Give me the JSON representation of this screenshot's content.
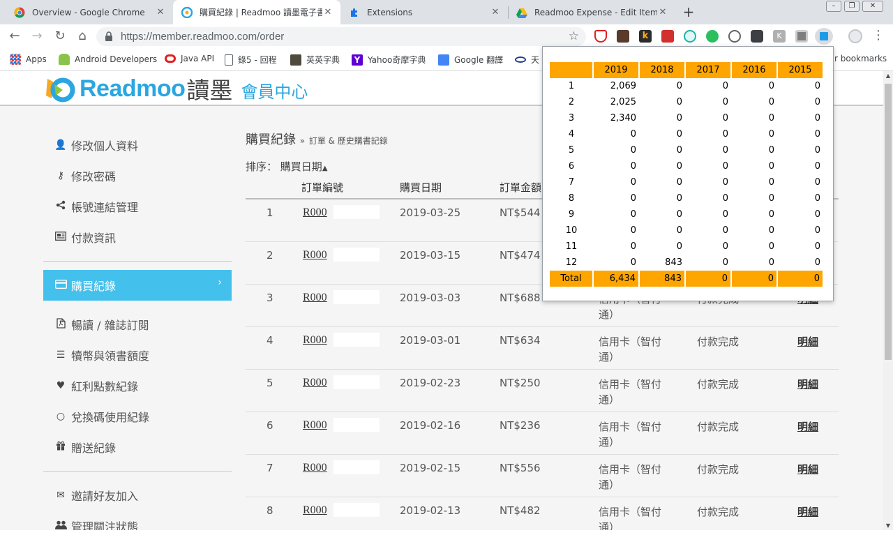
{
  "browser": {
    "tabs": [
      {
        "title": "Overview - Google Chrome",
        "active": false
      },
      {
        "title": "購買紀錄 | Readmoo 讀墨電子書",
        "active": true
      },
      {
        "title": "Extensions",
        "active": false
      },
      {
        "title": "Readmoo Expense - Edit Item",
        "active": false
      }
    ],
    "url_host": "https://member.readmoo.com",
    "url_path": "/order",
    "bookmarks": [
      {
        "label": "Apps",
        "icon": "apps-grid-icon"
      },
      {
        "label": "Android Developers",
        "icon": "android-icon"
      },
      {
        "label": "Java API",
        "icon": "oracle-icon"
      },
      {
        "label": "錄5 - 回程",
        "icon": "document-icon"
      },
      {
        "label": "英英字典",
        "icon": "book-icon"
      },
      {
        "label": "Yahoo奇摩字典",
        "icon": "yahoo-icon"
      },
      {
        "label": "Google 翻譯",
        "icon": "translate-icon"
      },
      {
        "label": "天",
        "icon": "eye-icon"
      }
    ],
    "other_bookmarks": "r bookmarks"
  },
  "site": {
    "brand": "Readmoo",
    "brand_zh": "讀墨",
    "member_center": "會員中心"
  },
  "sidebar": {
    "items": [
      {
        "label": "修改個人資料",
        "icon": "user-icon"
      },
      {
        "label": "修改密碼",
        "icon": "key-icon"
      },
      {
        "label": "帳號連結管理",
        "icon": "share-icon"
      },
      {
        "label": "付款資訊",
        "icon": "newspaper-icon"
      }
    ],
    "active_item": {
      "label": "購買紀錄",
      "icon": "credit-card-icon",
      "chevron": "›"
    },
    "items2": [
      {
        "label": "暢讀 / 雜誌訂閱",
        "icon": "pdf-file-icon"
      },
      {
        "label": "犢幣與領書額度",
        "icon": "list-icon"
      },
      {
        "label": "紅利點數紀錄",
        "icon": "heart-icon"
      },
      {
        "label": "兌換碼使用紀錄",
        "icon": "circle-icon"
      },
      {
        "label": "贈送紀錄",
        "icon": "gift-icon"
      }
    ],
    "items3": [
      {
        "label": "邀請好友加入",
        "icon": "envelope-icon"
      },
      {
        "label": "管理關注狀態",
        "icon": "users-icon"
      }
    ]
  },
  "main": {
    "title": "購買紀錄",
    "breadcrumb_sep": "»",
    "breadcrumb_sub": "訂單 & 歷史購書記錄",
    "sort_label": "排序：",
    "sort_value": "購買日期",
    "sort_caret": "▲",
    "columns": [
      "訂單編號",
      "購買日期",
      "訂單金額"
    ],
    "rows": [
      {
        "num": "1",
        "order": "R000",
        "date": "2019-03-25",
        "amount": "NT$544",
        "pay": "",
        "status": "",
        "detail": ""
      },
      {
        "num": "2",
        "order": "R000",
        "date": "2019-03-15",
        "amount": "NT$474",
        "pay": "",
        "status": "",
        "detail": ""
      },
      {
        "num": "3",
        "order": "R000",
        "date": "2019-03-03",
        "amount": "NT$688",
        "pay": "信用卡（智付通）",
        "status": "付款完成",
        "detail": "明細"
      },
      {
        "num": "4",
        "order": "R000",
        "date": "2019-03-01",
        "amount": "NT$634",
        "pay": "信用卡（智付通）",
        "status": "付款完成",
        "detail": "明細"
      },
      {
        "num": "5",
        "order": "R000",
        "date": "2019-02-23",
        "amount": "NT$250",
        "pay": "信用卡（智付通）",
        "status": "付款完成",
        "detail": "明細"
      },
      {
        "num": "6",
        "order": "R000",
        "date": "2019-02-16",
        "amount": "NT$236",
        "pay": "信用卡（智付通）",
        "status": "付款完成",
        "detail": "明細"
      },
      {
        "num": "7",
        "order": "R000",
        "date": "2019-02-15",
        "amount": "NT$556",
        "pay": "信用卡（智付通）",
        "status": "付款完成",
        "detail": "明細"
      },
      {
        "num": "8",
        "order": "R000",
        "date": "2019-02-13",
        "amount": "NT$482",
        "pay": "信用卡（智付通）",
        "status": "付款完成",
        "detail": "明細"
      }
    ]
  },
  "popup": {
    "headers": [
      "",
      "2019",
      "2018",
      "2017",
      "2016",
      "2015"
    ],
    "rows": [
      [
        "1",
        "2,069",
        "0",
        "0",
        "0",
        "0"
      ],
      [
        "2",
        "2,025",
        "0",
        "0",
        "0",
        "0"
      ],
      [
        "3",
        "2,340",
        "0",
        "0",
        "0",
        "0"
      ],
      [
        "4",
        "0",
        "0",
        "0",
        "0",
        "0"
      ],
      [
        "5",
        "0",
        "0",
        "0",
        "0",
        "0"
      ],
      [
        "6",
        "0",
        "0",
        "0",
        "0",
        "0"
      ],
      [
        "7",
        "0",
        "0",
        "0",
        "0",
        "0"
      ],
      [
        "8",
        "0",
        "0",
        "0",
        "0",
        "0"
      ],
      [
        "9",
        "0",
        "0",
        "0",
        "0",
        "0"
      ],
      [
        "10",
        "0",
        "0",
        "0",
        "0",
        "0"
      ],
      [
        "11",
        "0",
        "0",
        "0",
        "0",
        "0"
      ],
      [
        "12",
        "0",
        "843",
        "0",
        "0",
        "0"
      ]
    ],
    "total": [
      "Total",
      "6,434",
      "843",
      "0",
      "0",
      "0"
    ]
  },
  "colors": {
    "accent": "#44c0ec",
    "popup_header": "#ffa500",
    "member_center": "#2aa6e0"
  }
}
